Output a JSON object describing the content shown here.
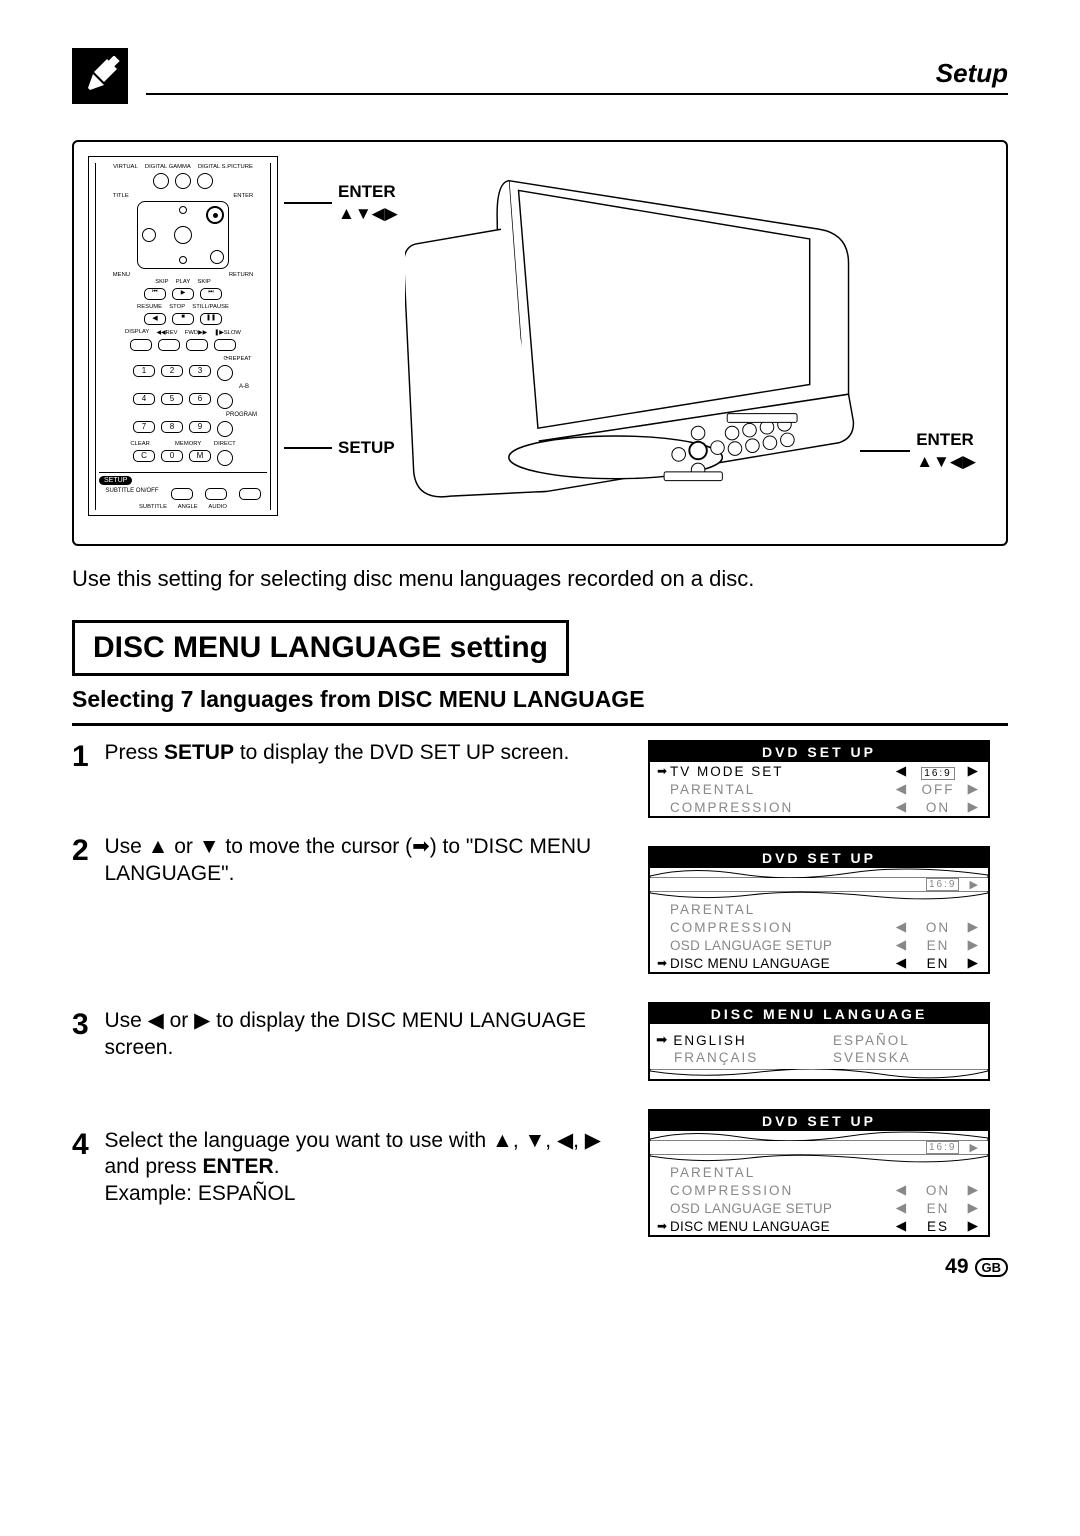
{
  "header": {
    "title": "Setup"
  },
  "diagram": {
    "callout_enter": "ENTER",
    "callout_setup": "SETUP",
    "callout_enter2": "ENTER",
    "remote_labels_top": [
      "VIRTUAL",
      "DIGITAL GAMMA",
      "DIGITAL S.PICTURE"
    ],
    "remote_dpad_labels": [
      "TITLE",
      "ENTER",
      "MENU",
      "RETURN"
    ],
    "remote_transport": [
      "SKIP",
      "PLAY",
      "SKIP"
    ],
    "remote_transport2": [
      "RESUME",
      "STOP",
      "STILL/PAUSE"
    ],
    "remote_row3": [
      "DISPLAY",
      "REV",
      "FWD",
      "SLOW"
    ],
    "remote_repeat": "REPEAT",
    "remote_keypad": [
      "1",
      "2",
      "3",
      "4",
      "5",
      "6",
      "7",
      "8",
      "9",
      "C",
      "0",
      "M"
    ],
    "remote_keypad_extra": [
      "A-B",
      "PROGRAM",
      "CLEAR",
      "MEMORY",
      "DIRECT"
    ],
    "remote_bottom_row": [
      "SETUP",
      "SUBTITLE ON/OFF",
      "SUBTITLE",
      "ANGLE",
      "AUDIO"
    ]
  },
  "intro": "Use this setting for selecting disc menu languages recorded on a disc.",
  "section_title": "DISC MENU LANGUAGE setting",
  "sub_title": "Selecting 7 languages from DISC MENU LANGUAGE",
  "steps": [
    {
      "n": "1",
      "body_a": "Press ",
      "b1": "SETUP",
      "body_b": " to display the DVD SET UP screen."
    },
    {
      "n": "2",
      "body_a": "Use ▲ or ▼ to move the cursor (➡) to \"DISC MENU LANGUAGE\"."
    },
    {
      "n": "3",
      "body_a": "Use ◀ or ▶ to display the DISC MENU LANGUAGE screen."
    },
    {
      "n": "4",
      "body_a": "Select the language you want to use with ▲, ▼, ◀, ▶ and press ",
      "b1": "ENTER",
      "body_b": ".",
      "line2": "Example: ESPAÑOL"
    }
  ],
  "osd1": {
    "header": "DVD SET UP",
    "rows": [
      {
        "ptr": "➡",
        "label": "TV MODE SET",
        "val": "16:9",
        "box": true,
        "active": true
      },
      {
        "label": "PARENTAL",
        "val": "OFF"
      },
      {
        "label": "COMPRESSION",
        "val": "ON"
      }
    ]
  },
  "osd2": {
    "header": "DVD SET UP",
    "torn_top": true,
    "rows_top": [
      {
        "val": "16:9",
        "box": true
      }
    ],
    "rows": [
      {
        "label": "PARENTAL",
        "novalarrows": true
      },
      {
        "label": "COMPRESSION",
        "val": "ON"
      },
      {
        "label": "OSD LANGUAGE SETUP",
        "val": "EN",
        "tight": true
      },
      {
        "ptr": "➡",
        "label": "DISC MENU LANGUAGE",
        "val": "EN",
        "active": true,
        "tight": true
      }
    ]
  },
  "osd3": {
    "header": "DISC MENU LANGUAGE",
    "langs": [
      {
        "t": "ENGLISH",
        "active": true,
        "ptr": true
      },
      {
        "t": "ESPAÑOL"
      },
      {
        "t": "FRANÇAIS"
      },
      {
        "t": "SVENSKA"
      }
    ],
    "torn_bot": true
  },
  "osd4": {
    "header": "DVD SET UP",
    "torn_top": true,
    "rows_top": [
      {
        "val": "16:9",
        "box": true
      }
    ],
    "rows": [
      {
        "label": "PARENTAL",
        "novalarrows": true
      },
      {
        "label": "COMPRESSION",
        "val": "ON"
      },
      {
        "label": "OSD LANGUAGE SETUP",
        "val": "EN",
        "tight": true
      },
      {
        "ptr": "➡",
        "label": "DISC MENU LANGUAGE",
        "val": "ES",
        "active": true,
        "tight": true
      }
    ]
  },
  "footer": {
    "page": "49",
    "region": "GB"
  },
  "glyphs": {
    "arrows4": "▲▼◀▶",
    "up": "▲",
    "down": "▼",
    "left": "◀",
    "right": "▶",
    "ptr_right": "➡",
    "small_left": "◀",
    "small_right": "▶"
  }
}
